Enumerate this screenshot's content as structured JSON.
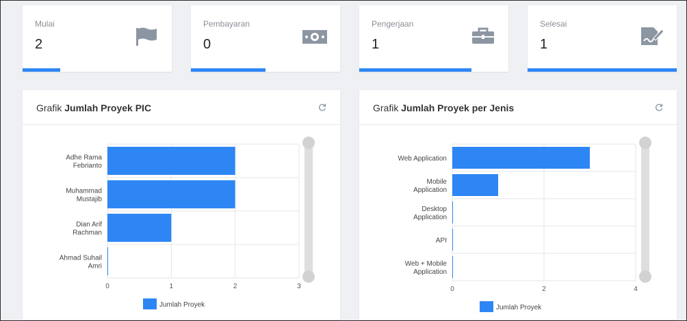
{
  "stats": [
    {
      "label": "Mulai",
      "value": "2",
      "icon": "flag-icon",
      "progress": 0.25
    },
    {
      "label": "Pembayaran",
      "value": "0",
      "icon": "money-icon",
      "progress": 0.5
    },
    {
      "label": "Pengerjaan",
      "value": "1",
      "icon": "toolbox-icon",
      "progress": 0.75
    },
    {
      "label": "Selesai",
      "value": "1",
      "icon": "signature-icon",
      "progress": 1.0
    }
  ],
  "panels": [
    {
      "title_prefix": "Grafik ",
      "title_bold": "Jumlah Proyek PIC"
    },
    {
      "title_prefix": "Grafik ",
      "title_bold": "Jumlah Proyek per Jenis"
    }
  ],
  "colors": {
    "accent": "#2e86f5",
    "icon": "#8c96a3"
  },
  "chart_data": [
    {
      "type": "bar",
      "orientation": "horizontal",
      "categories": [
        "Adhe Rama Febrianto",
        "Muhammad Mustajib",
        "Dian Arif Rachman",
        "Ahmad Suhail Amri"
      ],
      "category_lines": [
        [
          "Adhe Rama",
          "Febrianto"
        ],
        [
          "Muhammad",
          "Mustajib"
        ],
        [
          "Dian Arif",
          "Rachman"
        ],
        [
          "Ahmad Suhail",
          "Amri"
        ]
      ],
      "series": [
        {
          "name": "Jumlah Proyek",
          "values": [
            2,
            2,
            1,
            0
          ]
        }
      ],
      "xlim": [
        0,
        3
      ],
      "xticks": [
        "0",
        "1",
        "2",
        "3"
      ],
      "grid": true,
      "legend": "bottom"
    },
    {
      "type": "bar",
      "orientation": "horizontal",
      "categories": [
        "Web Application",
        "Mobile Application",
        "Desktop Application",
        "API",
        "Web + Mobile Application"
      ],
      "category_lines": [
        [
          "Web Application"
        ],
        [
          "Mobile",
          "Application"
        ],
        [
          "Desktop",
          "Application"
        ],
        [
          "API"
        ],
        [
          "Web + Mobile",
          "Application"
        ]
      ],
      "series": [
        {
          "name": "Jumlah Proyek",
          "values": [
            3,
            1,
            0,
            0,
            0
          ]
        }
      ],
      "xlim": [
        0,
        4
      ],
      "xticks": [
        "0",
        "2",
        "4"
      ],
      "grid": true,
      "legend": "bottom"
    }
  ]
}
